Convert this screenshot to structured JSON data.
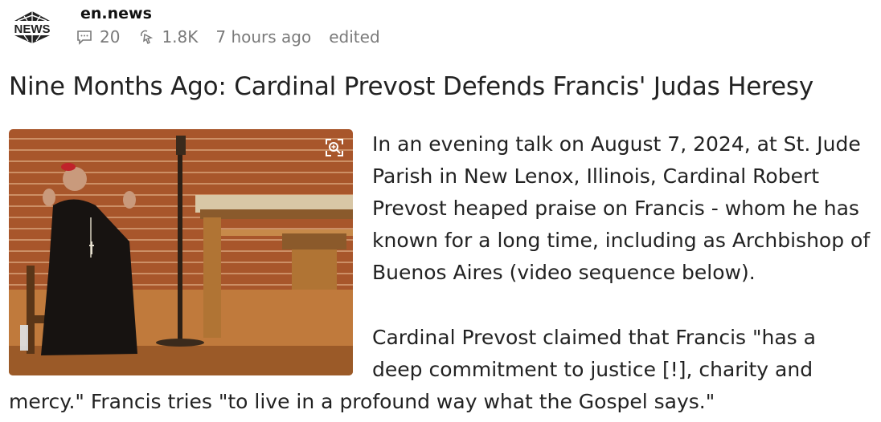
{
  "post": {
    "source_name": "en.news",
    "logo_text": "NEWS",
    "comment_count": "20",
    "view_count": "1.8K",
    "time_ago": "7 hours ago",
    "edited_label": "edited",
    "title": "Nine Months Ago: Cardinal Prevost Defends Francis' Judas Heresy",
    "paragraph1": "In an evening talk on August 7, 2024, at St. Jude Parish in New Lenox, Illinois, Cardinal Robert Prevost heaped praise on Francis - whom he has known for a long time, including as Archbishop of Buenos Aires (video sequence below).",
    "paragraph2_line1": "Cardinal Prevost claimed that Francis \"has a",
    "paragraph2_line2": "deep commitment to justice [!], charity and",
    "paragraph2_line3": "mercy.\" Francis tries \"to live in a profound way what the Gospel says.\""
  },
  "icons": {
    "comments": "speech-bubble-icon",
    "views": "cursor-click-icon",
    "zoom": "zoom-in-icon"
  }
}
